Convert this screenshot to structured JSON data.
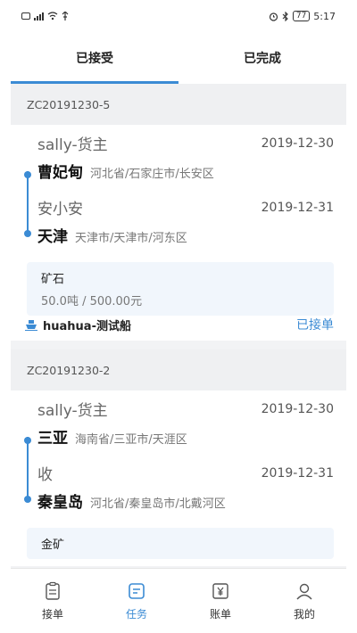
{
  "status_bar": {
    "battery": "77",
    "time": "5:17"
  },
  "tabs": [
    {
      "label": "已接受",
      "active": true
    },
    {
      "label": "已完成",
      "active": false
    }
  ],
  "orders": [
    {
      "id": "ZC20191230-5",
      "from": {
        "name": "sally-货主",
        "date": "2019-12-30",
        "city": "曹妃甸",
        "address": "河北省/石家庄市/长安区"
      },
      "to": {
        "name": "安小安",
        "date": "2019-12-31",
        "city": "天津",
        "address": "天津市/天津市/河东区"
      },
      "cargo": {
        "name": "矿石",
        "quantity": "50.0吨 / 500.00元"
      },
      "ship": "huahua-测试船",
      "status": "已接单"
    },
    {
      "id": "ZC20191230-2",
      "from": {
        "name": "sally-货主",
        "date": "2019-12-30",
        "city": "三亚",
        "address": "海南省/三亚市/天涯区"
      },
      "to": {
        "name": "收",
        "date": "2019-12-31",
        "city": "秦皇岛",
        "address": "河北省/秦皇岛市/北戴河区"
      },
      "cargo": {
        "name": "金矿"
      }
    }
  ],
  "bottom_nav": [
    {
      "label": "接单",
      "icon": "clipboard-icon",
      "active": false
    },
    {
      "label": "任务",
      "icon": "task-icon",
      "active": true
    },
    {
      "label": "账单",
      "icon": "bill-icon",
      "active": false
    },
    {
      "label": "我的",
      "icon": "user-icon",
      "active": false
    }
  ],
  "colors": {
    "accent": "#3b8bd4"
  }
}
